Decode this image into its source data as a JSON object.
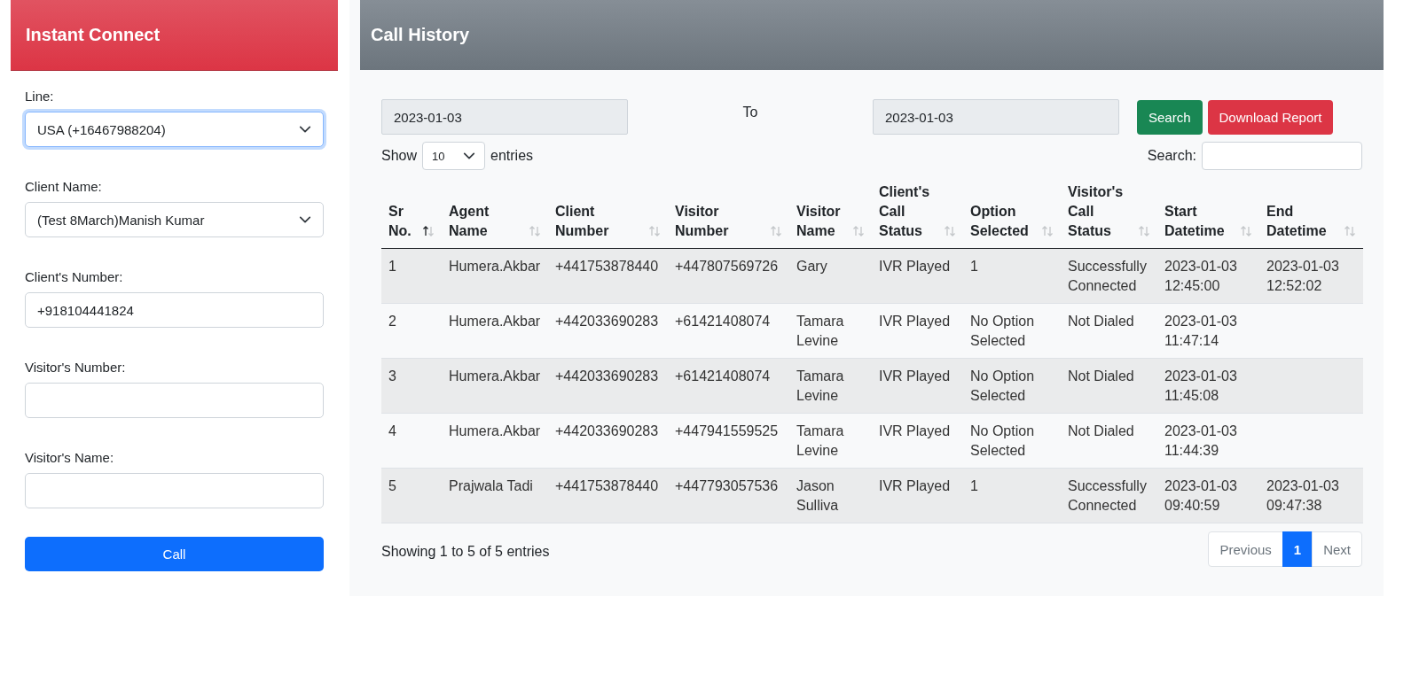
{
  "left_panel": {
    "title": "Instant Connect",
    "fields": [
      {
        "kind": "select",
        "label": "Line:",
        "value": "USA (+16467988204)",
        "focused": true
      },
      {
        "kind": "select",
        "label": "Client Name:",
        "value": "(Test 8March)Manish Kumar",
        "focused": false
      },
      {
        "kind": "input",
        "label": "Client's Number:",
        "value": "+918104441824",
        "focused": false
      },
      {
        "kind": "input",
        "label": "Visitor's Number:",
        "focused": false
      },
      {
        "kind": "input",
        "label": "Visitor's Name:",
        "focused": false
      }
    ],
    "call_button": "Call"
  },
  "main_panel": {
    "title": "Call History",
    "date_from": "2023-01-03",
    "to_label": "To",
    "date_to": "2023-01-03",
    "search_button": "Search",
    "download_button": "Download Report",
    "show_label": "Show",
    "page_size": "10",
    "entries_label": "entries",
    "search_label": "Search:",
    "table": {
      "columns": [
        {
          "label": "Sr No.",
          "sorted": true
        },
        {
          "label": "Agent Name",
          "sorted": false
        },
        {
          "label": "Client Number",
          "sorted": false
        },
        {
          "label": "Visitor Number",
          "sorted": false
        },
        {
          "label": "Visitor Name",
          "sorted": false
        },
        {
          "label": "Client's Call Status",
          "sorted": false
        },
        {
          "label": "Option Selected",
          "sorted": false
        },
        {
          "label": "Visitor's Call Status",
          "sorted": false
        },
        {
          "label": "Start Datetime",
          "sorted": false
        },
        {
          "label": "End Datetime",
          "sorted": false
        }
      ],
      "rows": [
        [
          "1",
          "Humera.Akbar",
          "+441753878440",
          "+447807569726",
          "Gary",
          "IVR Played",
          "1",
          "Successfully Connected",
          "2023-01-03 12:45:00",
          "2023-01-03 12:52:02"
        ],
        [
          "2",
          "Humera.Akbar",
          "+442033690283",
          "+61421408074",
          "Tamara Levine",
          "IVR Played",
          "No Option Selected",
          "Not Dialed",
          "2023-01-03 11:47:14",
          ""
        ],
        [
          "3",
          "Humera.Akbar",
          "+442033690283",
          "+61421408074",
          "Tamara Levine",
          "IVR Played",
          "No Option Selected",
          "Not Dialed",
          "2023-01-03 11:45:08",
          ""
        ],
        [
          "4",
          "Humera.Akbar",
          "+442033690283",
          "+447941559525",
          "Tamara Levine",
          "IVR Played",
          "No Option Selected",
          "Not Dialed",
          "2023-01-03 11:44:39",
          ""
        ],
        [
          "5",
          "Prajwala Tadi",
          "+441753878440",
          "+447793057536",
          "Jason Sulliva",
          "IVR Played",
          "1",
          "Successfully Connected",
          "2023-01-03 09:40:59",
          "2023-01-03 09:47:38"
        ]
      ]
    },
    "info": "Showing 1 to 5 of 5 entries",
    "pagination": [
      {
        "label": "Previous",
        "selected": false,
        "disabled": true
      },
      {
        "label": "1",
        "selected": true,
        "disabled": false
      },
      {
        "label": "Next",
        "selected": false,
        "disabled": true
      }
    ]
  }
}
